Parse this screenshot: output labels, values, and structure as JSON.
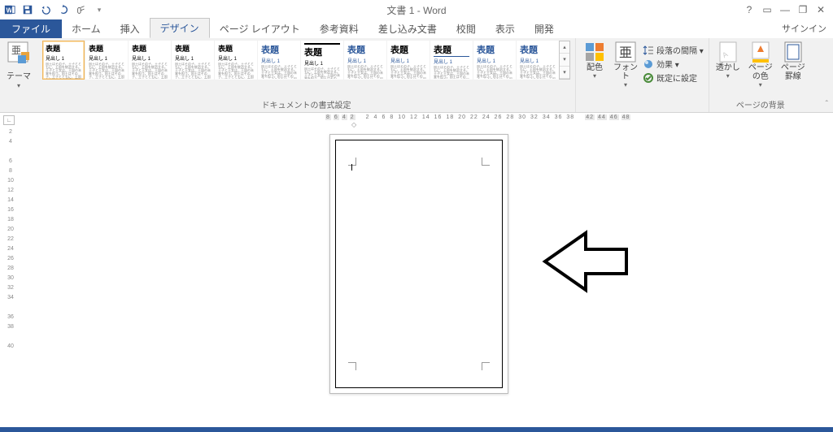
{
  "title_bar": {
    "title": "文書 1 - Word"
  },
  "qat": [
    "word",
    "save",
    "undo",
    "redo",
    "touch"
  ],
  "window_controls": {
    "help": "?",
    "ribbon_opts": "▭",
    "min": "—",
    "restore": "❐",
    "close": "✕"
  },
  "tabs": {
    "file": "ファイル",
    "items": [
      "ホーム",
      "挿入",
      "デザイン",
      "ページ レイアウト",
      "参考資料",
      "差し込み文書",
      "校閲",
      "表示",
      "開発"
    ],
    "active_index": 2,
    "signin": "サインイン"
  },
  "ribbon": {
    "themes": {
      "label": "テーマ",
      "dropdown": "▾"
    },
    "gallery": {
      "label": "ドキュメントの書式設定",
      "styles": [
        {
          "title": "表題",
          "sub": "見出し 1",
          "color": "#000",
          "accent": "#000"
        },
        {
          "title": "表題",
          "sub": "見出し 1",
          "color": "#000",
          "accent": "#000"
        },
        {
          "title": "表題",
          "sub": "見出し 1",
          "color": "#000",
          "accent": "#000"
        },
        {
          "title": "表題",
          "sub": "見出し 1",
          "color": "#000",
          "accent": "#000"
        },
        {
          "title": "表題",
          "sub": "見出し 1",
          "color": "#000",
          "accent": "#000"
        },
        {
          "title": "表題",
          "sub": "見出し 1",
          "color": "#2b579a",
          "accent": "#2b579a"
        },
        {
          "title": "表題",
          "sub": "見出し 1",
          "color": "#000",
          "accent": "#000",
          "bar": true
        },
        {
          "title": "表題",
          "sub": "見出し 1",
          "color": "#2b579a",
          "accent": "#2b579a"
        },
        {
          "title": "表題",
          "sub": "見出し 1",
          "color": "#000",
          "accent": "#2b579a"
        },
        {
          "title": "表題",
          "sub": "見出し 1",
          "color": "#000",
          "accent": "#2b579a",
          "under": true
        },
        {
          "title": "表題",
          "sub": "見出し 1",
          "color": "#2b579a",
          "accent": "#2b579a"
        },
        {
          "title": "表題",
          "sub": "見出し 1",
          "color": "#2b579a",
          "accent": "#2b579a"
        }
      ]
    },
    "colors": {
      "label": "配色",
      "dropdown": "▾"
    },
    "fonts": {
      "label": "フォント",
      "glyph": "亜",
      "dropdown": "▾"
    },
    "para_spacing": "段落の間隔 ▾",
    "effects": "効果 ▾",
    "set_default": "既定に設定",
    "watermark": {
      "label": "透かし",
      "dropdown": "▾"
    },
    "page_color": {
      "label": "ページの色",
      "dropdown": "▾"
    },
    "page_border": {
      "label_l1": "ページ",
      "label_l2": "罫線"
    },
    "page_bg_label": "ページの背景"
  },
  "ruler": {
    "left": [
      "8",
      "6",
      "4",
      "2"
    ],
    "mid": [
      "2",
      "4",
      "6",
      "8",
      "10",
      "12",
      "14",
      "16",
      "18",
      "20",
      "22",
      "24",
      "26",
      "28",
      "30",
      "32",
      "34",
      "36",
      "38"
    ],
    "right": [
      "42",
      "44",
      "46",
      "48"
    ]
  },
  "vruler": [
    "2",
    "4",
    "",
    "6",
    "8",
    "10",
    "12",
    "14",
    "16",
    "18",
    "20",
    "22",
    "24",
    "26",
    "28",
    "30",
    "32",
    "34",
    "",
    "36",
    "38",
    "",
    "40"
  ]
}
